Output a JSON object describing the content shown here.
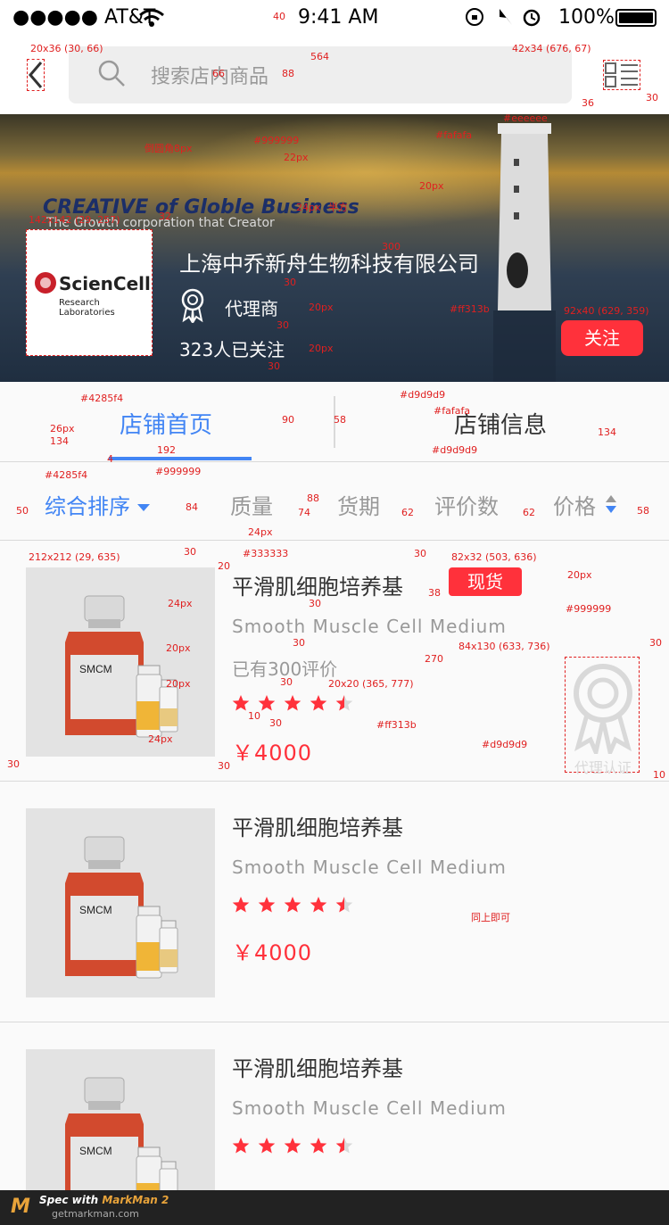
{
  "status": {
    "carrier": "●●●●● AT&T",
    "time": "9:41 AM",
    "battery": "100%"
  },
  "search": {
    "placeholder": "搜索店内商品"
  },
  "shop": {
    "name": "上海中乔新舟生物科技有限公司",
    "type": "代理商",
    "followers": "323人已关注",
    "follow_label": "关注",
    "logo_brand": "ScienCell",
    "logo_sub": "Research Laboratories",
    "banner_slogan": "CREATIVE of Globle Business",
    "banner_sub": "The Growth corporation that Creator"
  },
  "tabs": {
    "home": "店铺首页",
    "info": "店铺信息"
  },
  "sort": {
    "all": "综合排序",
    "quality": "质量",
    "delivery": "货期",
    "reviews": "评价数",
    "price": "价格"
  },
  "products": [
    {
      "name": "平滑肌细胞培养基",
      "en": "Smooth Muscle Cell Medium",
      "reviews": "已有300评价",
      "rating": 4.5,
      "price": "￥4000",
      "stock": "现货",
      "cert": "代理认证",
      "bottle_label": "SMCM"
    },
    {
      "name": "平滑肌细胞培养基",
      "en": "Smooth Muscle Cell Medium",
      "rating": 4.5,
      "price": "￥4000",
      "bottle_label": "SMCM"
    },
    {
      "name": "平滑肌细胞培养基",
      "en": "Smooth Muscle Cell Medium",
      "rating": 4.5,
      "bottle_label": "SMCM"
    }
  ],
  "colors": {
    "accent": "#4285f4",
    "red": "#ff313b",
    "grey_text": "#999999",
    "divider": "#d9d9d9",
    "bg": "#fafafa",
    "search_bg": "#eeeeee",
    "dark_text": "#333333"
  },
  "annotations": [
    "20x36 (30, 66)",
    "40",
    "564",
    "42x34 (676, 67)",
    "66",
    "88",
    "30",
    "36",
    "#eeeeee",
    "倒圆角8px",
    "#999999",
    "22px",
    "#fafafa",
    "24px",
    "半方",
    "20px",
    "142x142 (29, 257)",
    "32",
    "300",
    "30",
    "20px",
    "#ff313b",
    "92x40 (629, 359)",
    "30",
    "20px",
    "30",
    "#4285f4",
    "#d9d9d9",
    "#fafafa",
    "26px",
    "58",
    "134",
    "90",
    "134",
    "192",
    "4",
    "#d9d9d9",
    "#4285f4",
    "#999999",
    "88",
    "50",
    "84",
    "74",
    "62",
    "62",
    "58",
    "24px",
    "212x212 (29, 635)",
    "30",
    "20",
    "#333333",
    "30",
    "82x32 (503, 636)",
    "20px",
    "24px",
    "38",
    "30",
    "#999999",
    "20px",
    "30",
    "84x130 (633, 736)",
    "30",
    "270",
    "20px",
    "30",
    "20x20 (365, 777)",
    "10",
    "30",
    "#ff313b",
    "24px",
    "#d9d9d9",
    "30",
    "30",
    "10",
    "同上即可"
  ],
  "footer": {
    "text": "Spec with",
    "product": "MarkMan 2",
    "url": "getmarkman.com"
  }
}
